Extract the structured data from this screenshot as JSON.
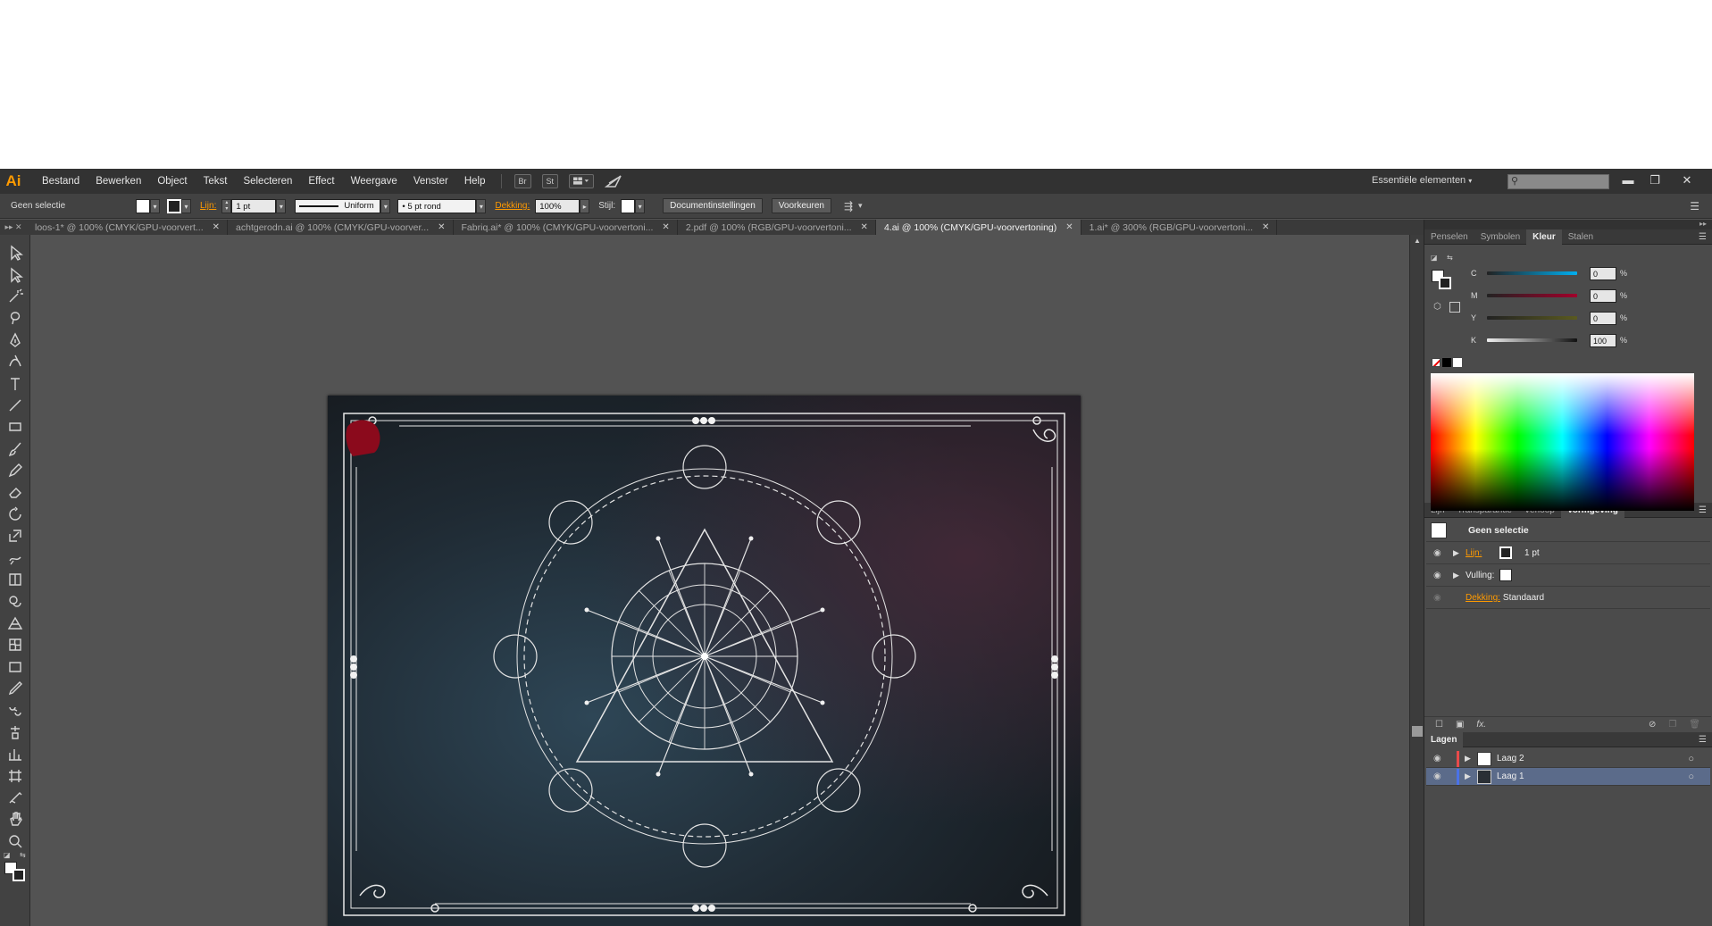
{
  "app": {
    "logo": "Ai"
  },
  "menu": {
    "items": [
      "Bestand",
      "Bewerken",
      "Object",
      "Tekst",
      "Selecteren",
      "Effect",
      "Weergave",
      "Venster",
      "Help"
    ],
    "bridge_btn": "Br",
    "stock_btn": "St",
    "workspace": "Essentiële elementen"
  },
  "control": {
    "selection": "Geen selectie",
    "stroke_label": "Lijn:",
    "stroke_value": "1 pt",
    "profile": "Uniform",
    "brush": "5 pt rond",
    "opacity_label": "Dekking:",
    "opacity_value": "100%",
    "style_label": "Stijl:",
    "doc_settings": "Documentinstellingen",
    "preferences": "Voorkeuren"
  },
  "tabs": [
    {
      "label": "loos-1* @ 100% (CMYK/GPU-voorvert...",
      "active": false
    },
    {
      "label": "achtgerodn.ai @ 100% (CMYK/GPU-voorver...",
      "active": false
    },
    {
      "label": "Fabriq.ai* @ 100% (CMYK/GPU-voorvertoni...",
      "active": false
    },
    {
      "label": "2.pdf @ 100% (RGB/GPU-voorvertoni...",
      "active": false
    },
    {
      "label": "4.ai @ 100% (CMYK/GPU-voorvertoning)",
      "active": true
    },
    {
      "label": "1.ai* @ 300% (RGB/GPU-voorvertoni...",
      "active": false
    }
  ],
  "panels": {
    "color_tabs": [
      "Penselen",
      "Symbolen",
      "Kleur",
      "Stalen"
    ],
    "cmyk": [
      {
        "label": "C",
        "value": "0",
        "color": "#00aeef"
      },
      {
        "label": "M",
        "value": "0",
        "color": "#ec008c"
      },
      {
        "label": "Y",
        "value": "0",
        "color": "#fff200"
      },
      {
        "label": "K",
        "value": "100",
        "color": "#000000"
      }
    ],
    "pct": "%",
    "appearance_tabs": [
      "Lijn",
      "Transparantie",
      "Verloop",
      "Vormgeving"
    ],
    "appearance": {
      "title": "Geen selectie",
      "stroke_label": "Lijn:",
      "stroke_value": "1 pt",
      "fill_label": "Vulling:",
      "opacity_label": "Dekking:",
      "opacity_value": "Standaard"
    },
    "layers_title": "Lagen",
    "layers": [
      {
        "name": "Laag 2",
        "color": "#e84a4a",
        "selected": false
      },
      {
        "name": "Laag 1",
        "color": "#4a72e8",
        "selected": true
      }
    ]
  },
  "tools": [
    "selection-tool",
    "direct-selection-tool",
    "magic-wand-tool",
    "lasso-tool",
    "pen-tool",
    "curvature-tool",
    "type-tool",
    "line-tool",
    "rectangle-tool",
    "paintbrush-tool",
    "pencil-tool",
    "eraser-tool",
    "rotate-tool",
    "scale-tool",
    "warp-tool",
    "free-transform-tool",
    "shape-builder-tool",
    "perspective-grid-tool",
    "mesh-tool",
    "gradient-tool",
    "eyedropper-tool",
    "blend-tool",
    "symbol-sprayer-tool",
    "column-graph-tool",
    "artboard-tool",
    "slice-tool",
    "hand-tool",
    "zoom-tool"
  ]
}
